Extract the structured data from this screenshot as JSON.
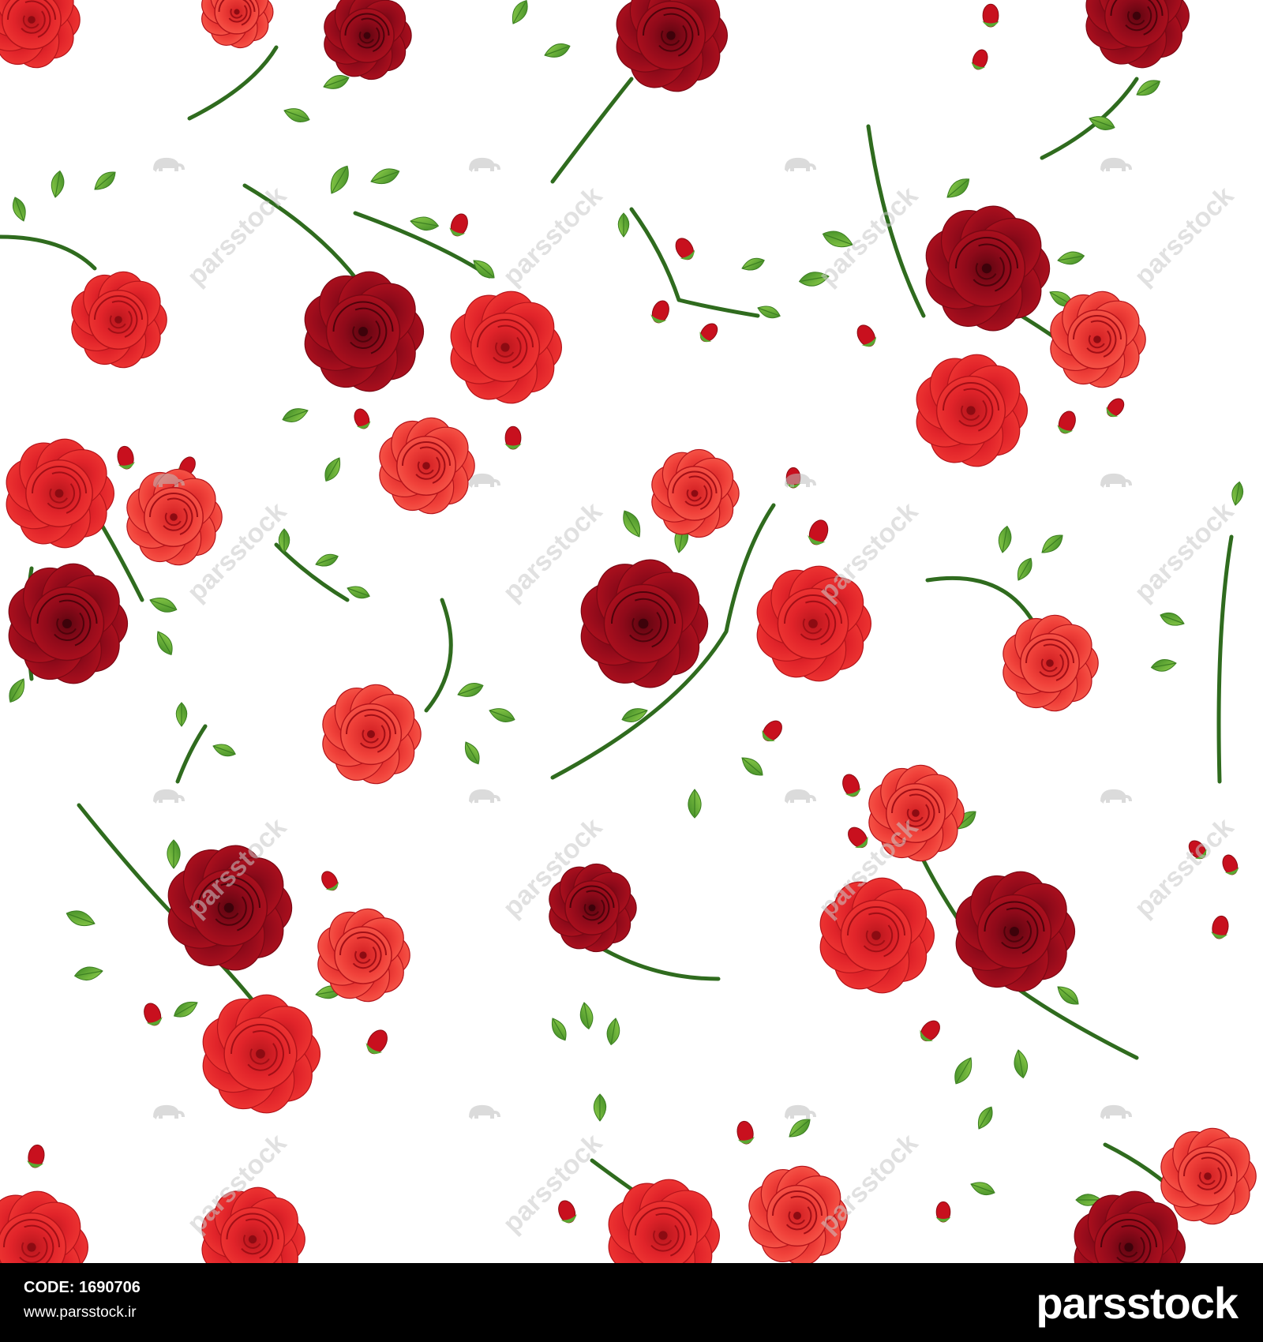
{
  "image": {
    "description_kind": "seamless floral pattern stock image",
    "background_color": "#ffffff",
    "palette": {
      "deep_red": "#9e0b1c",
      "crimson": "#c8101e",
      "bright_red": "#e8262a",
      "coral_red": "#f2453c",
      "stem_green": "#2f6b1e",
      "leaf_green": "#5aa832",
      "leaf_light": "#8fcf4a"
    }
  },
  "watermark": {
    "text": "parsstock",
    "icon": "elephant-icon"
  },
  "footer": {
    "code": "CODE: 1690706",
    "url": "www.parsstock.ir",
    "brand": "parsstock",
    "background": "#000000",
    "text_color": "#ffffff"
  }
}
